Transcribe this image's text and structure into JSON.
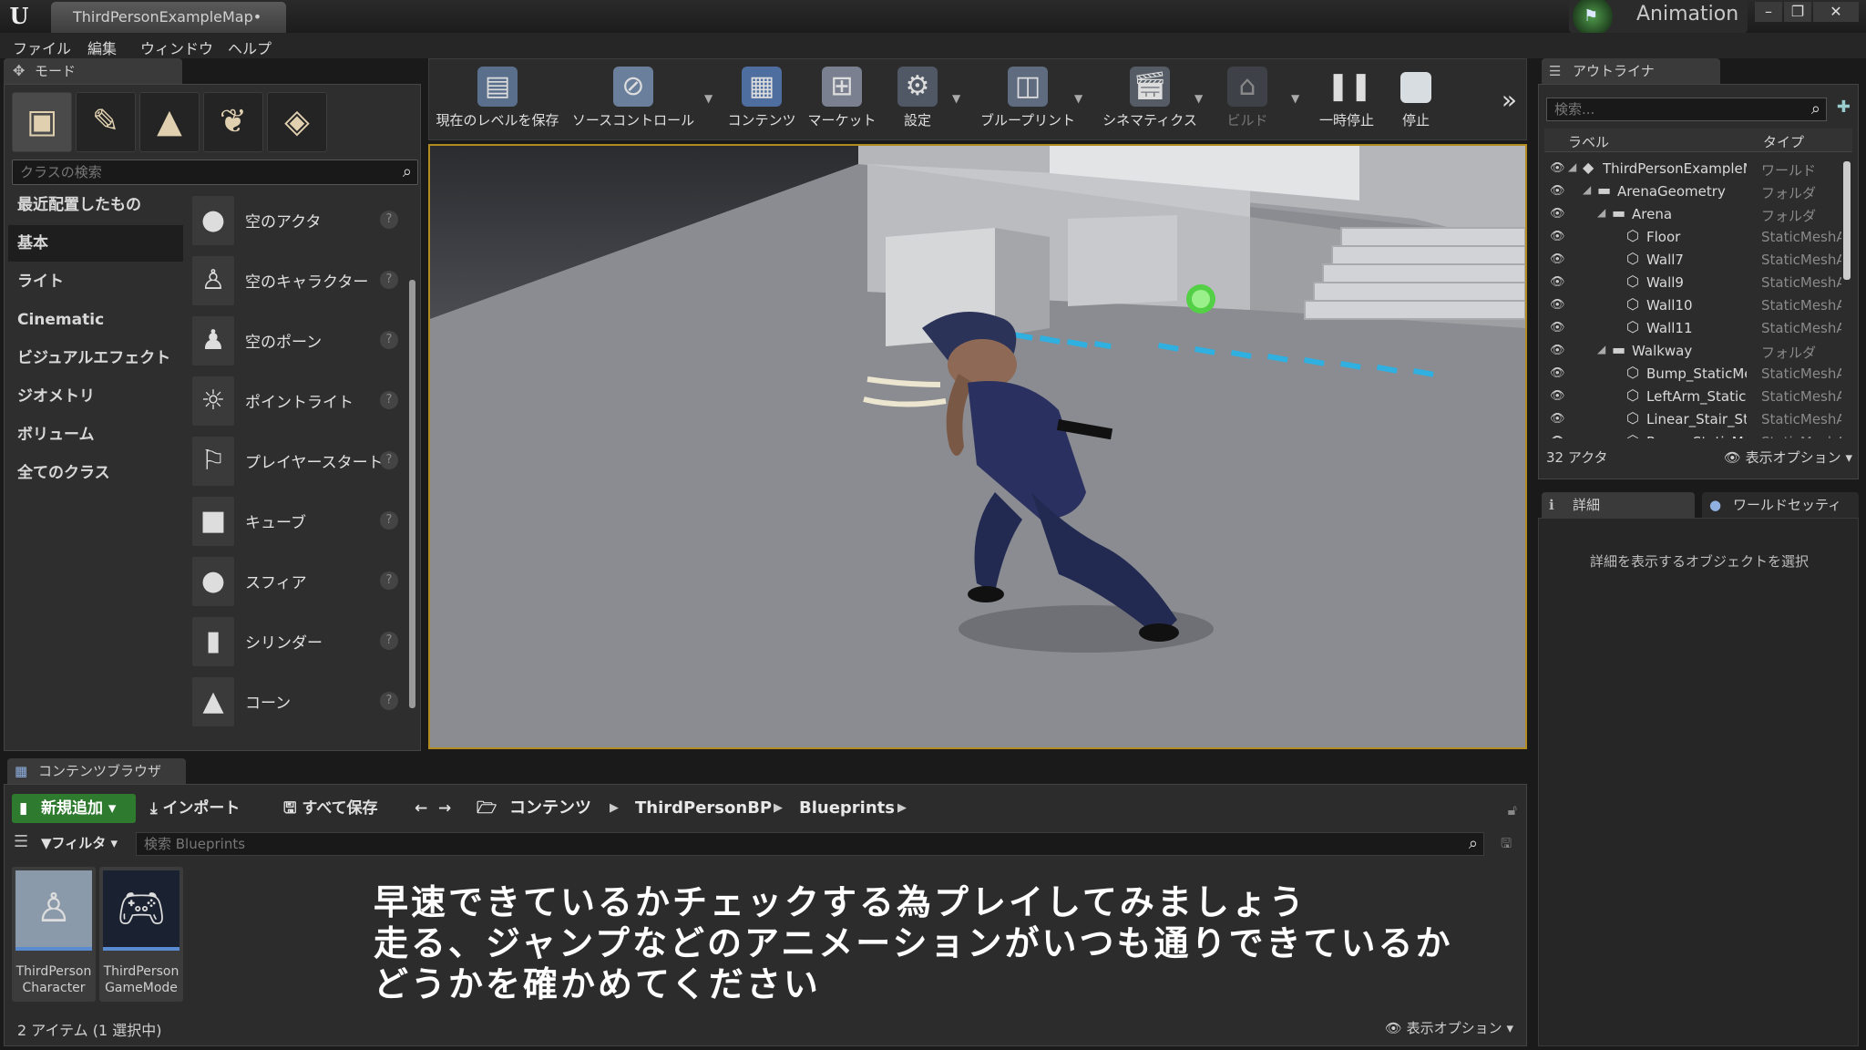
{
  "window": {
    "tab_title": "ThirdPersonExampleMap•",
    "project_name": "Animation",
    "minimize": "–",
    "restore": "❐",
    "close": "✕"
  },
  "menu": [
    "ファイル",
    "編集",
    "ウィンドウ",
    "ヘルプ"
  ],
  "modes": {
    "tab_label": "モード",
    "search_placeholder": "クラスの検索",
    "categories": [
      "最近配置したもの",
      "基本",
      "ライト",
      "Cinematic",
      "ビジュアルエフェクト",
      "ジオメトリ",
      "ボリューム",
      "全てのクラス"
    ],
    "selected_category": "基本",
    "actors": [
      "空のアクタ",
      "空のキャラクター",
      "空のポーン",
      "ポイントライト",
      "プレイヤースタート",
      "キューブ",
      "スフィア",
      "シリンダー",
      "コーン"
    ]
  },
  "toolbar": {
    "buttons": [
      {
        "label": "現在のレベルを保存",
        "icon": "save-icon"
      },
      {
        "label": "ソースコントロール",
        "icon": "source-control-icon"
      },
      {
        "label": "コンテンツ",
        "icon": "content-icon"
      },
      {
        "label": "マーケット",
        "icon": "marketplace-icon"
      },
      {
        "label": "設定",
        "icon": "settings-icon"
      },
      {
        "label": "ブループリント",
        "icon": "blueprint-icon"
      },
      {
        "label": "シネマティクス",
        "icon": "cinematics-icon"
      },
      {
        "label": "ビルド",
        "icon": "build-icon"
      },
      {
        "label": "一時停止",
        "icon": "pause-icon"
      },
      {
        "label": "停止",
        "icon": "stop-icon"
      }
    ]
  },
  "outliner": {
    "tab_label": "アウトライナ",
    "search_placeholder": "検索...",
    "col_label": "ラベル",
    "col_type": "タイプ",
    "rows": [
      {
        "label": "ThirdPersonExampleMap",
        "type": "ワールド",
        "indent": 0
      },
      {
        "label": "ArenaGeometry",
        "type": "フォルダ",
        "indent": 1
      },
      {
        "label": "Arena",
        "type": "フォルダ",
        "indent": 2
      },
      {
        "label": "Floor",
        "type": "StaticMeshActor",
        "indent": 3
      },
      {
        "label": "Wall7",
        "type": "StaticMeshActor",
        "indent": 3
      },
      {
        "label": "Wall9",
        "type": "StaticMeshActor",
        "indent": 3
      },
      {
        "label": "Wall10",
        "type": "StaticMeshActor",
        "indent": 3
      },
      {
        "label": "Wall11",
        "type": "StaticMeshActor",
        "indent": 3
      },
      {
        "label": "Walkway",
        "type": "フォルダ",
        "indent": 2
      },
      {
        "label": "Bump_StaticMesh",
        "type": "StaticMeshActor",
        "indent": 3
      },
      {
        "label": "LeftArm_StaticMesh",
        "type": "StaticMeshActor",
        "indent": 3
      },
      {
        "label": "Linear_Stair_StaticMesh",
        "type": "StaticMeshActor",
        "indent": 3
      },
      {
        "label": "Ramp_StaticMesh",
        "type": "StaticMeshActor",
        "indent": 3
      }
    ],
    "actor_count": "32 アクタ",
    "view_options": "表示オプション"
  },
  "details": {
    "tab_label": "詳細",
    "world_settings_tab": "ワールドセッティング",
    "hint": "詳細を表示するオブジェクトを選択"
  },
  "content_browser": {
    "tab_label": "コンテンツブラウザ",
    "add_new": "新規追加",
    "import": "インポート",
    "save_all": "すべて保存",
    "breadcrumbs": [
      "コンテンツ",
      "ThirdPersonBP",
      "Blueprints"
    ],
    "filter": "フィルタ",
    "search_placeholder": "検索 Blueprints",
    "assets": [
      {
        "name1": "ThirdPerson",
        "name2": "Character"
      },
      {
        "name1": "ThirdPerson",
        "name2": "GameMode"
      }
    ],
    "item_count": "2 アイテム (1 選択中)",
    "view_options": "表示オプション"
  },
  "subtitle": [
    "早速できているかチェックする為プレイしてみましょう",
    "走る、ジャンプなどのアニメーションがいつも通りできているか",
    "どうかを確かめてください"
  ],
  "colors": {
    "viewport_border": "#b28c20",
    "add_new_button": "#2e7a2e",
    "floor_marker": "#2fb0e0"
  }
}
